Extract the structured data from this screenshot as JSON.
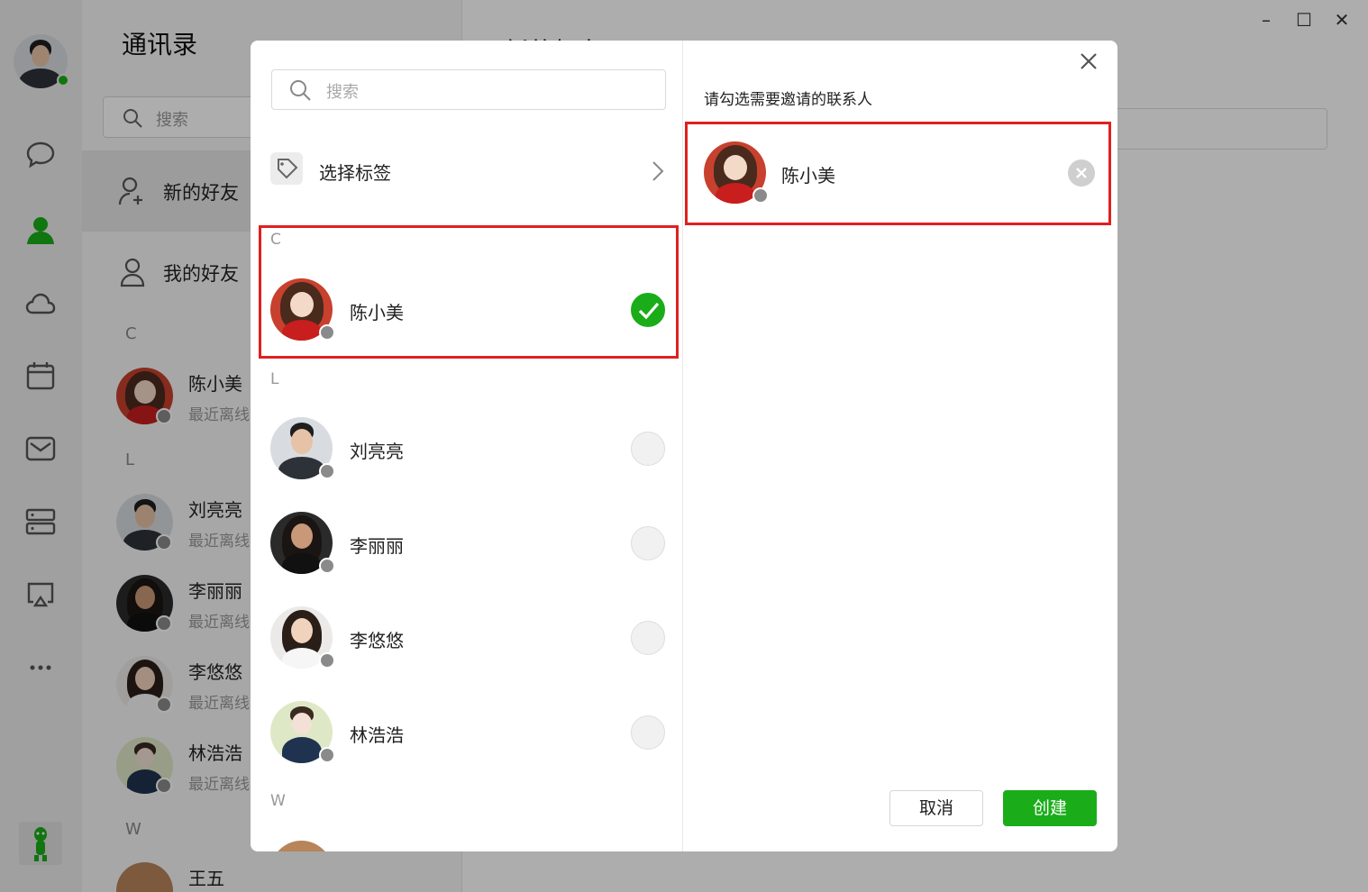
{
  "background": {
    "panel_title": "通讯录",
    "main_title": "新的好友",
    "search_placeholder": "搜索",
    "nav": [
      {
        "label": "新的好友"
      },
      {
        "label": "我的好友"
      }
    ],
    "sections": [
      "C",
      "L",
      "W"
    ],
    "contacts": [
      {
        "name": "陈小美",
        "status": "最近离线"
      },
      {
        "name": "刘亮亮",
        "status": "最近离线"
      },
      {
        "name": "李丽丽",
        "status": "最近离线"
      },
      {
        "name": "李悠悠",
        "status": "最近离线"
      },
      {
        "name": "林浩浩",
        "status": "最近离线"
      },
      {
        "name": "王五",
        "status": ""
      }
    ],
    "window_controls": {
      "minimize": "–",
      "maximize": "☐",
      "close": "✕"
    }
  },
  "dialog": {
    "search_placeholder": "搜索",
    "tag_select_label": "选择标签",
    "sections": [
      "C",
      "L",
      "W"
    ],
    "contacts": [
      {
        "name": "陈小美",
        "checked": true
      },
      {
        "name": "刘亮亮",
        "checked": false
      },
      {
        "name": "李丽丽",
        "checked": false
      },
      {
        "name": "李悠悠",
        "checked": false
      },
      {
        "name": "林浩浩",
        "checked": false
      }
    ],
    "right_hint": "请勾选需要邀请的联系人",
    "selected": [
      {
        "name": "陈小美"
      }
    ],
    "cancel_label": "取消",
    "create_label": "创建"
  },
  "colors": {
    "accent_green": "#1aad19",
    "highlight_red": "#e02020",
    "offline_dot": "#8a8a8a"
  }
}
